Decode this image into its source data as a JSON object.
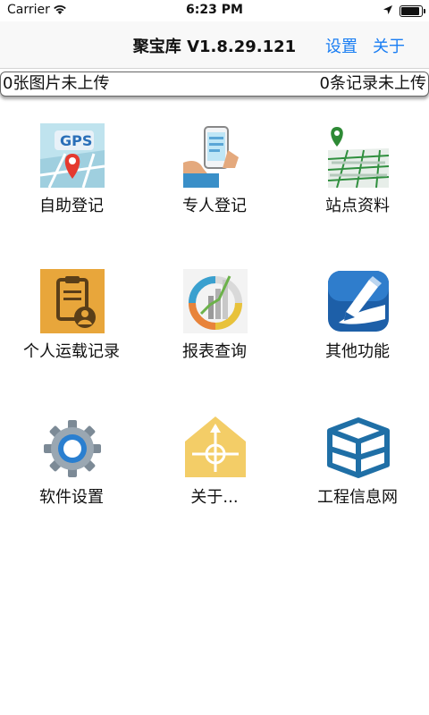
{
  "status_bar": {
    "carrier": "Carrier",
    "time": "6:23 PM",
    "battery_level": 0.9
  },
  "nav": {
    "title": "聚宝库 V1.8.29.121",
    "settings_label": "设置",
    "about_label": "关于"
  },
  "info_bar": {
    "pending_images": "0张图片未上传",
    "pending_records": "0条记录未上传"
  },
  "menu": [
    {
      "label": "自助登记",
      "icon": "gps-map-icon"
    },
    {
      "label": "专人登记",
      "icon": "phone-hand-icon"
    },
    {
      "label": "站点资料",
      "icon": "map-pin-icon"
    },
    {
      "label": "个人运载记录",
      "icon": "clipboard-user-icon"
    },
    {
      "label": "报表查询",
      "icon": "report-chart-icon"
    },
    {
      "label": "其他功能",
      "icon": "pen-icon"
    },
    {
      "label": "软件设置",
      "icon": "gear-icon"
    },
    {
      "label": "关于...",
      "icon": "house-compass-icon"
    },
    {
      "label": "工程信息网",
      "icon": "box-network-icon"
    }
  ],
  "colors": {
    "accent": "#1a7ef3",
    "nav_bg": "#f8f8f8"
  }
}
